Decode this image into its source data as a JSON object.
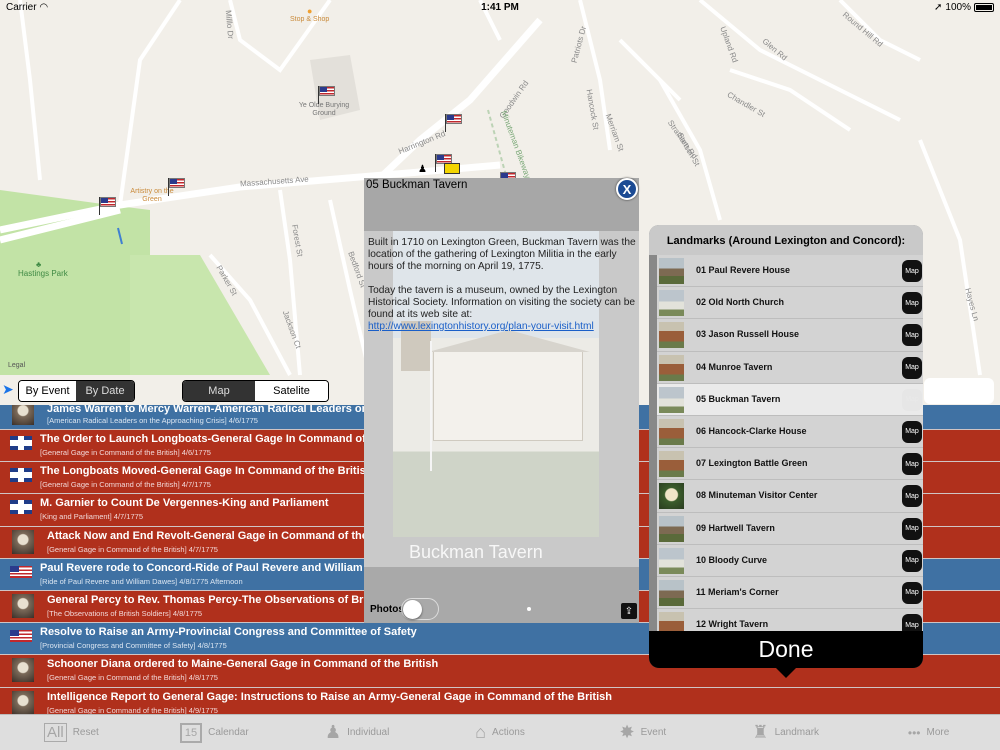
{
  "status_bar": {
    "carrier": "Carrier",
    "time": "1:41 PM",
    "battery": "100%"
  },
  "map": {
    "legal": "Legal",
    "streets": [
      "Massachusetts Ave",
      "Harrington Rd",
      "Forest St",
      "Parker St",
      "Jackson Ct",
      "Bedford St",
      "Hancock St",
      "Glen Rd",
      "Round Hill Rd",
      "Stratham Rd",
      "Chandler St",
      "Merriam St",
      "Stetson St",
      "Upland Rd",
      "Hayes Ln",
      "Goodwin Rd",
      "Patriots Dr",
      "Minuteman Bikeway",
      "Mill St",
      "Milllo Dr"
    ],
    "pois": [
      "Stop & Shop",
      "Ye Olde Burying Ground",
      "Artistry on the Green",
      "Hastings Park"
    ]
  },
  "controls": {
    "by_event": "By Event",
    "by_date": "By Date",
    "map_btn": "Map",
    "satellite_btn": "Satelite"
  },
  "events": [
    {
      "title": "James Warren to Mercy Warren-American Radical Leaders on the",
      "sub": "[American Radical Leaders on the Approaching Crisis] 4/6/1775",
      "color": "blue",
      "icon": "portrait"
    },
    {
      "title": "The Order to Launch Longboats-General Gage In Command of the",
      "sub": "[General Gage in Command of the British] 4/6/1775",
      "color": "red",
      "icon": "uk"
    },
    {
      "title": "The Longboats Moved-General Gage In Command of the British",
      "sub": "[General Gage in Command of the British] 4/7/1775",
      "color": "red",
      "icon": "uk"
    },
    {
      "title": "M. Garnier to Count De Vergennes-King and Parliament",
      "sub": "[King and Parliament] 4/7/1775",
      "color": "red",
      "icon": "uk"
    },
    {
      "title": "Attack Now and End Revolt-General Gage in Command of the Brit",
      "sub": "[General Gage in Command of the British] 4/7/1775",
      "color": "red",
      "icon": "portrait"
    },
    {
      "title": "Paul Revere rode to Concord-Ride of Paul Revere and William Daw",
      "sub": "[Ride of Paul Revere and William Dawes] 4/8/1775 Afternoon",
      "color": "blue",
      "icon": "us"
    },
    {
      "title": "General Percy to Rev. Thomas Percy-The Observations of British",
      "sub": "[The Observations of British Soldiers] 4/8/1775",
      "color": "red",
      "icon": "portrait"
    },
    {
      "title": "Resolve to Raise an Army-Provincial Congress and Committee of Safety",
      "sub": "[Provincial Congress and Committee of Safety] 4/8/1775",
      "color": "blue",
      "icon": "us"
    },
    {
      "title": "Schooner Diana ordered to Maine-General Gage in Command of the British",
      "sub": "[General Gage in Command of the British] 4/8/1775",
      "color": "red",
      "icon": "portrait"
    },
    {
      "title": "Intelligence Report to General Gage: Instructions to Raise an Army-General Gage in Command of the British",
      "sub": "[General Gage in Command of the British] 4/9/1775",
      "color": "red",
      "icon": "portrait"
    }
  ],
  "tabs": [
    {
      "label": "Reset",
      "icon": "all-icon",
      "glyph": "All"
    },
    {
      "label": "Calendar",
      "icon": "calendar-icon",
      "glyph": "15"
    },
    {
      "label": "Individual",
      "icon": "person-icon",
      "glyph": "♟"
    },
    {
      "label": "Actions",
      "icon": "house-icon",
      "glyph": "⌂"
    },
    {
      "label": "Event",
      "icon": "burst-icon",
      "glyph": "✸"
    },
    {
      "label": "Landmark",
      "icon": "monument-icon",
      "glyph": "♜"
    },
    {
      "label": "More",
      "icon": "more-icon",
      "glyph": "•••"
    }
  ],
  "landmarks": {
    "header": "Landmarks (Around Lexington and Concord):",
    "map_label": "Map",
    "done": "Done",
    "items": [
      {
        "name": "01 Paul Revere House",
        "style": "a"
      },
      {
        "name": "02 Old North Church",
        "style": "c"
      },
      {
        "name": "03 Jason Russell House",
        "style": "b"
      },
      {
        "name": "04 Munroe Tavern",
        "style": "b"
      },
      {
        "name": "05 Buckman Tavern",
        "style": "c",
        "selected": true
      },
      {
        "name": "06 Hancock-Clarke House",
        "style": "b"
      },
      {
        "name": "07 Lexington Battle Green",
        "style": "b"
      },
      {
        "name": "08 Minuteman Visitor Center",
        "style": "d"
      },
      {
        "name": "09 Hartwell Tavern",
        "style": "a"
      },
      {
        "name": "10 Bloody Curve",
        "style": "c"
      },
      {
        "name": "11 Meriam's Corner",
        "style": "a"
      },
      {
        "name": "12 Wright Tavern",
        "style": "b"
      }
    ]
  },
  "dialog": {
    "title": "05 Buckman Tavern",
    "close": "X",
    "para1": "Built in 1710 on Lexington Green, Buckman Tavern was the location of the gathering of Lexington Militia in the early hours of the morning on April 19, 1775.",
    "para2": "Today the tavern is a museum, owned by the Lexington Historical Society. Information on visiting the society can be found at its web site at: ",
    "link": "http://www.lexingtonhistory.org/plan-your-visit.html",
    "caption": "Buckman Tavern",
    "photos_label": "Photos",
    "photos_toggle_on": false
  }
}
